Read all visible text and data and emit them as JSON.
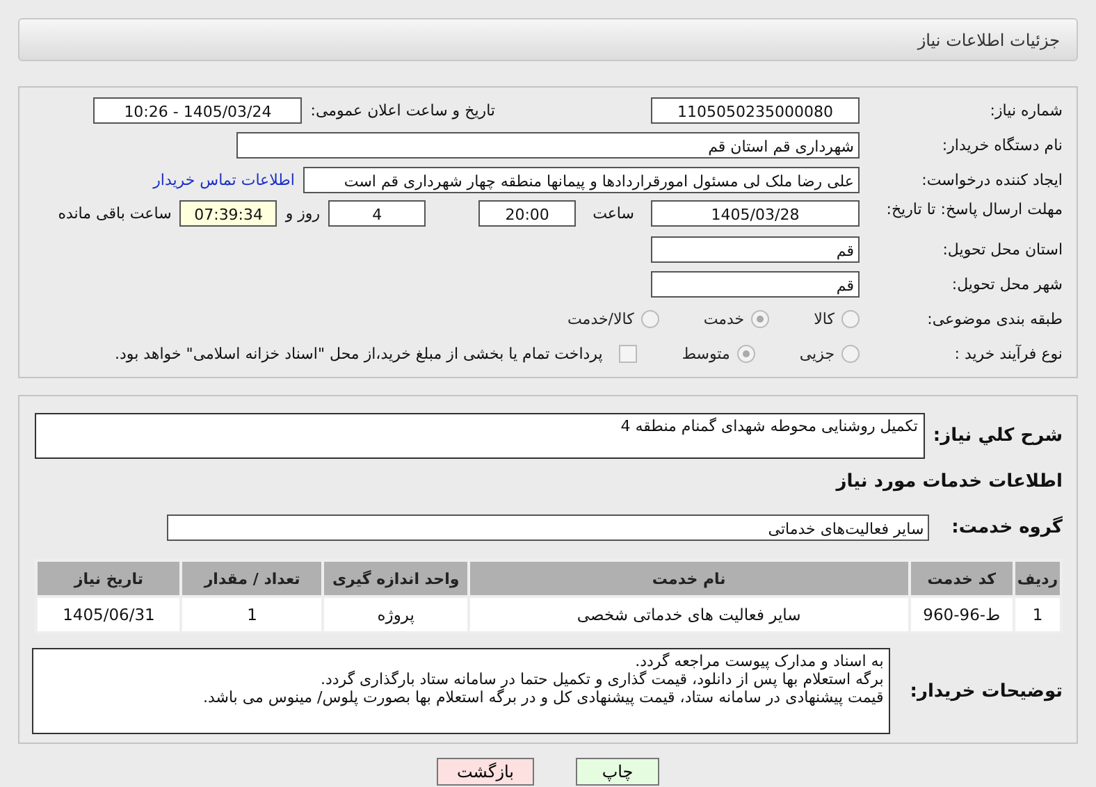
{
  "header": {
    "title": "جزئیات اطلاعات نیاز"
  },
  "details": {
    "need_number": {
      "label": "شماره نیاز:",
      "value": "1105050235000080"
    },
    "announce": {
      "label": "تاریخ و ساعت اعلان عمومی:",
      "value": "1405/03/24 - 10:26"
    },
    "buyer_org": {
      "label": "نام دستگاه خریدار:",
      "value": "شهرداری قم استان قم"
    },
    "requester": {
      "label": "ایجاد کننده درخواست:",
      "value": "علی رضا ملک لی مسئول امورقراردادها و پیمانها منطقه چهار  شهرداری قم است",
      "link": "اطلاعات تماس خریدار"
    },
    "deadline": {
      "label": "مهلت ارسال پاسخ: تا تاریخ:",
      "date": "1405/03/28",
      "time_label": "ساعت",
      "time": "20:00",
      "days": "4",
      "days_label": "روز و",
      "remaining": "07:39:34",
      "remaining_label": "ساعت باقی مانده"
    },
    "province": {
      "label": "استان محل تحویل:",
      "value": "قم"
    },
    "city": {
      "label": "شهر محل تحویل:",
      "value": "قم"
    },
    "category": {
      "label": "طبقه بندی موضوعی:",
      "options": [
        {
          "label": "کالا",
          "selected": false
        },
        {
          "label": "خدمت",
          "selected": true
        },
        {
          "label": "کالا/خدمت",
          "selected": false
        }
      ]
    },
    "process": {
      "label": "نوع فرآیند خرید :",
      "options": [
        {
          "label": "جزیی",
          "selected": false
        },
        {
          "label": "متوسط",
          "selected": true
        }
      ],
      "payment": {
        "checked": false,
        "text": "پرداخت تمام یا بخشی از مبلغ خرید،از محل \"اسناد خزانه اسلامی\" خواهد بود."
      }
    }
  },
  "need": {
    "description": {
      "label": "شرح کلي نياز:",
      "value": "تکمیل روشنایی محوطه شهدای گمنام منطقه 4"
    },
    "services_title": "اطلاعات خدمات مورد نیاز",
    "service_group": {
      "label": "گروه خدمت:",
      "value": "سایر فعالیت‌های خدماتی"
    },
    "table": {
      "columns": [
        "ردیف",
        "کد خدمت",
        "نام خدمت",
        "واحد اندازه گیری",
        "تعداد / مقدار",
        "تاریخ نیاز"
      ],
      "rows": [
        [
          "1",
          "ط-96-960",
          "سایر فعالیت های خدماتی شخصی",
          "پروژه",
          "1",
          "1405/06/31"
        ]
      ]
    },
    "buyer_notes": {
      "label": "توضیحات خریدار:",
      "value": "به اسناد و مدارک پیوست مراجعه گردد.\nبرگه استعلام بها پس از دانلود، قیمت گذاری و تکمیل حتما در سامانه ستاد بارگذاری گردد.\nقیمت پیشنهادی در سامانه ستاد، قیمت پیشنهادی کل و در برگه استعلام بها بصورت پلوس/ مینوس می باشد."
    }
  },
  "buttons": [
    {
      "label": "چاپ",
      "kind": "print"
    },
    {
      "label": "بازگشت",
      "kind": "back"
    }
  ]
}
